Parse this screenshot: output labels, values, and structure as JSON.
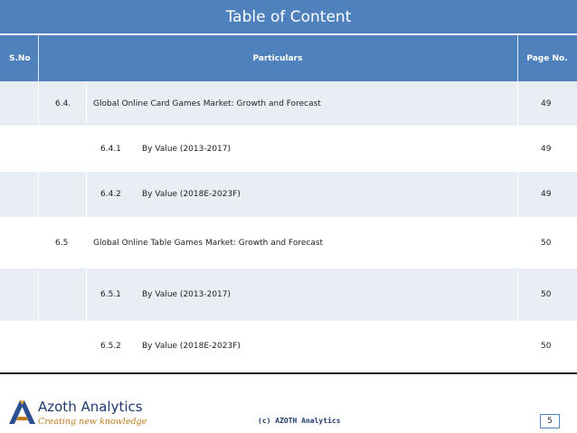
{
  "title": "Table of Content",
  "header": {
    "sno": "S.No",
    "particulars": "Particulars",
    "page": "Page No."
  },
  "rows": [
    {
      "num": "6.4.",
      "sub": "",
      "text": "Global Online Card Games Market: Growth and Forecast",
      "page": "49"
    },
    {
      "num": "",
      "sub": "6.4.1",
      "text": "By Value (2013-2017)",
      "page": "49"
    },
    {
      "num": "",
      "sub": "6.4.2",
      "text": "By Value (2018E-2023F)",
      "page": "49"
    },
    {
      "num": "6.5",
      "sub": "",
      "text": "Global Online Table Games Market: Growth and Forecast",
      "page": "50"
    },
    {
      "num": "",
      "sub": "6.5.1",
      "text": "By Value (2013-2017)",
      "page": "50"
    },
    {
      "num": "",
      "sub": "6.5.2",
      "text": "By Value (2018E-2023F)",
      "page": "50"
    }
  ],
  "footer": {
    "brand": "Azoth Analytics",
    "tagline": "Creating new knowledge",
    "copyright": "(c) AZOTH Analytics",
    "page_number": "5"
  },
  "colors": {
    "header_blue": "#4f81bd",
    "row_alt": "#e9edf4",
    "brand_navy": "#1f3a6e",
    "brand_orange": "#c07a1c"
  }
}
